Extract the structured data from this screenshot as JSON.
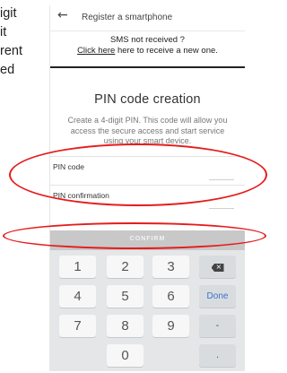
{
  "doc_fragments": [
    "igit",
    "it",
    "rent",
    "ed"
  ],
  "header": {
    "back_icon": "arrow-left-icon",
    "title": "Register a smartphone"
  },
  "sms": {
    "line1": "SMS not received ?",
    "link_text": "Click here",
    "line2_rest": " here to receive a new one."
  },
  "pin": {
    "title": "PIN code creation",
    "description": "Create a 4-digit PIN. This code will allow you access the secure access and start service using your smart device.",
    "code_label": "PIN code",
    "confirmation_label": "PIN confirmation"
  },
  "confirm_button": "CONFIRM",
  "keypad": {
    "keys": [
      "1",
      "2",
      "3",
      "4",
      "5",
      "6",
      "7",
      "8",
      "9",
      "0"
    ],
    "done_label": "Done",
    "minus_label": "-",
    "dot_label": ".",
    "delete_icon": "backspace-icon"
  },
  "colors": {
    "annotation": "#e51c1c",
    "confirm_disabled": "#c8c8c8",
    "done_blue": "#3b6fd1"
  }
}
